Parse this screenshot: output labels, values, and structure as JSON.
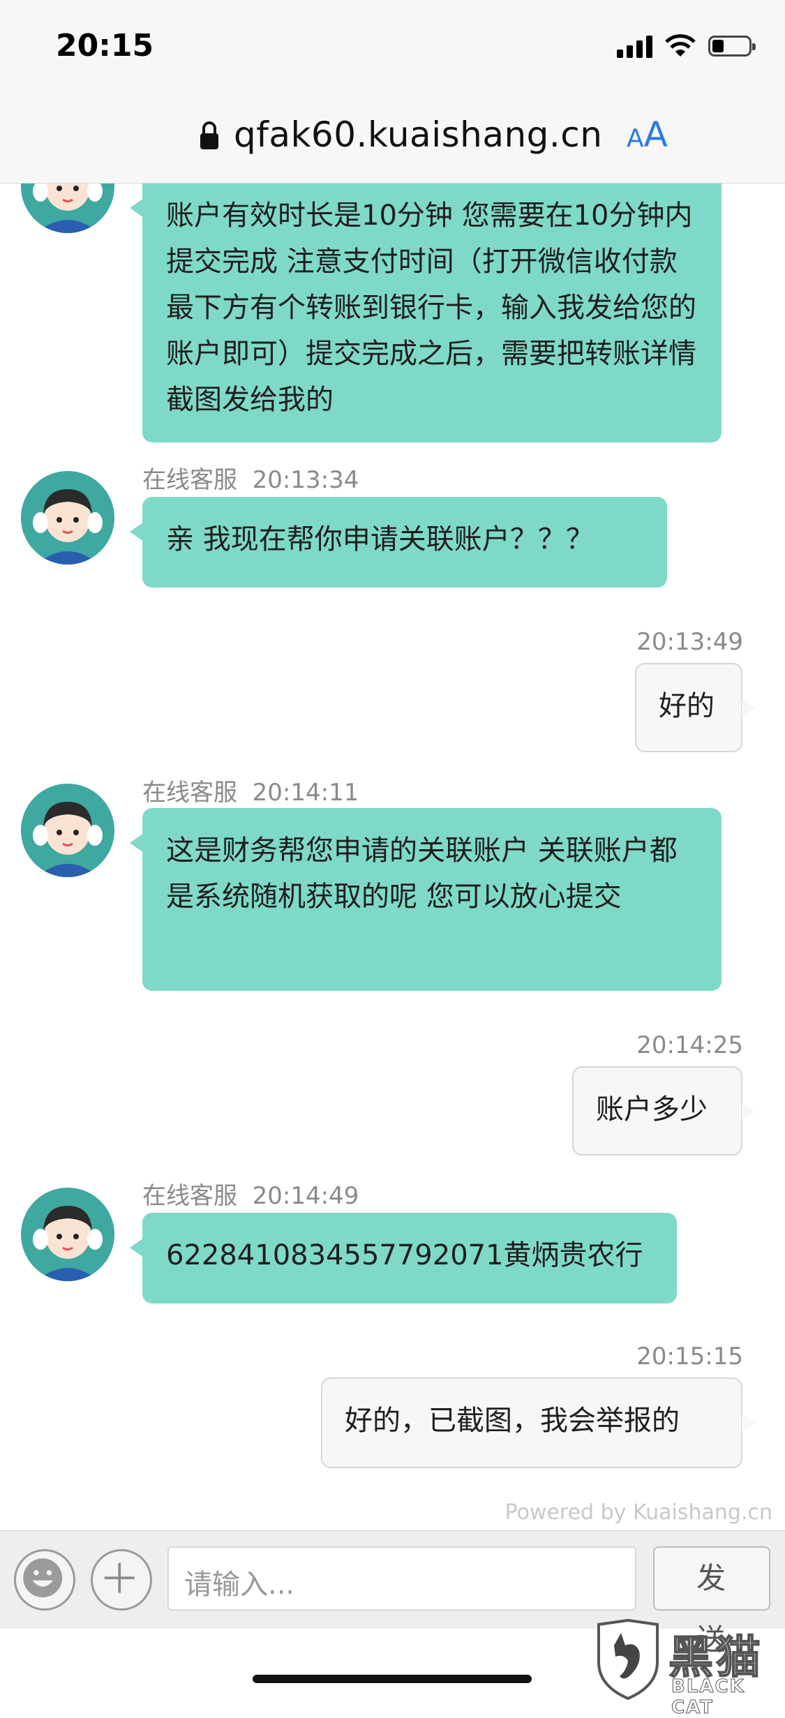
{
  "status": {
    "time": "20:15"
  },
  "browser": {
    "url": "qfak60.kuaishang.cn",
    "text_size_small": "A",
    "text_size_large": "A"
  },
  "messages": [
    {
      "side": "in",
      "text": "账户有效时长是10分钟 您需要在10分钟内提交完成 注意支付时间（打开微信收付款最下方有个转账到银行卡，输入我发给您的账户即可）提交完成之后，需要把转账详情截图发给我的"
    },
    {
      "side": "in",
      "sender": "在线客服",
      "time": "20:13:34",
      "text": "亲 我现在帮你申请关联账户？？？"
    },
    {
      "side": "out",
      "time": "20:13:49",
      "text": "好的"
    },
    {
      "side": "in",
      "sender": "在线客服",
      "time": "20:14:11",
      "text": "这是财务帮您申请的关联账户 关联账户都是系统随机获取的呢 您可以放心提交"
    },
    {
      "side": "out",
      "time": "20:14:25",
      "text": "账户多少"
    },
    {
      "side": "in",
      "sender": "在线客服",
      "time": "20:14:49",
      "text": "6228410834557792071黄炳贵农行"
    },
    {
      "side": "out",
      "time": "20:15:15",
      "text": "好的，已截图，我会举报的"
    }
  ],
  "footer": {
    "powered_by": "Powered by Kuaishang.cn"
  },
  "input_bar": {
    "placeholder": "请输入...",
    "send_label": "发 送",
    "emoji_icon": "smiley-icon",
    "plus_icon": "plus-icon"
  },
  "watermark": {
    "cn": "黑猫",
    "en": "BLACK CAT"
  },
  "colors": {
    "incoming_bubble": "#7fd9c8",
    "outgoing_bubble": "#f7f7f7",
    "link_accent": "#2a7ae2"
  }
}
